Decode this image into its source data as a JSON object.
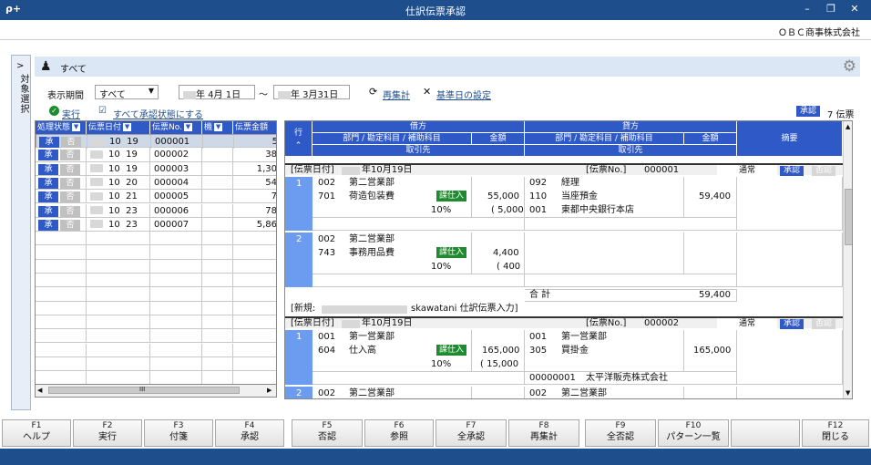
{
  "window": {
    "title": "仕訳伝票承認",
    "logo": "ρ+",
    "min": "–",
    "restore": "❐",
    "close": "✕",
    "company": "ＯＢＣ商事株式会社"
  },
  "side_tab": {
    "chevron": ">",
    "label": "対象選択"
  },
  "header_band": {
    "label": "すべて",
    "icon": "stamp-icon",
    "gear": "gear-icon"
  },
  "filters": {
    "period_label": "表示期間",
    "period_value": "すべて",
    "date_from_suffix": "年  4月  1日",
    "tilde": "～",
    "date_to_suffix": "年  3月31日",
    "recalc": "再集計",
    "base_date": "基準日の設定",
    "execute": "実行",
    "set_all": "すべて承認状態にする",
    "approved_badge": "承認",
    "count": "7 伝票"
  },
  "list": {
    "headers": [
      "処理状態",
      "伝票日付",
      "伝票No.",
      "機",
      "伝票金額"
    ],
    "approve": "承",
    "reject": "否",
    "rows": [
      {
        "mm": "10",
        "dd": "19",
        "no": "000001",
        "amt": "5"
      },
      {
        "mm": "10",
        "dd": "19",
        "no": "000002",
        "amt": "38"
      },
      {
        "mm": "10",
        "dd": "19",
        "no": "000003",
        "amt": "1,30"
      },
      {
        "mm": "10",
        "dd": "20",
        "no": "000004",
        "amt": "54"
      },
      {
        "mm": "10",
        "dd": "21",
        "no": "000005",
        "amt": "7"
      },
      {
        "mm": "10",
        "dd": "23",
        "no": "000006",
        "amt": "78"
      },
      {
        "mm": "10",
        "dd": "23",
        "no": "000007",
        "amt": "5,86"
      }
    ],
    "scroll_mark": "III"
  },
  "detail": {
    "col_row": "行",
    "debit": "借方",
    "credit": "貸方",
    "dept_acct": "部門 / 勘定科目 / 補助科目",
    "amount": "金額",
    "partner": "取引先",
    "memo": "摘要",
    "slips": [
      {
        "date_label": "[伝票日付]",
        "date": "年10月19日",
        "no_label": "[伝票No.]",
        "no": "000001",
        "normal": "通常",
        "approve": "承認",
        "reject": "否認",
        "lines": [
          {
            "n": "1",
            "d_dept_code": "002",
            "d_dept": "第二営業部",
            "d_acct_code": "701",
            "d_acct": "荷造包装費",
            "tax_badge": "課仕入",
            "d_amt": "55,000",
            "tax_rate": "10%",
            "tax_amt": "( 5,000",
            "c_dept_code": "092",
            "c_dept": "経理",
            "c_acct_code": "110",
            "c_acct": "当座預金",
            "c_sub_code": "001",
            "c_sub": "東都中央銀行本店",
            "c_amt": "59,400"
          },
          {
            "n": "2",
            "d_dept_code": "002",
            "d_dept": "第二営業部",
            "d_acct_code": "743",
            "d_acct": "事務用品費",
            "tax_badge": "課仕入",
            "d_amt": "4,400",
            "tax_rate": "10%",
            "tax_amt": "( 400"
          }
        ],
        "total_label": "合  計",
        "total": "59,400",
        "footer_prefix": "[新規:",
        "footer_user": "skawatani  仕訳伝票入力]"
      },
      {
        "date_label": "[伝票日付]",
        "date": "年10月19日",
        "no_label": "[伝票No.]",
        "no": "000002",
        "normal": "通常",
        "approve": "承認",
        "reject": "否認",
        "lines": [
          {
            "n": "1",
            "d_dept_code": "001",
            "d_dept": "第一営業部",
            "d_acct_code": "604",
            "d_acct": "仕入高",
            "tax_badge": "課仕入",
            "d_amt": "165,000",
            "tax_rate": "10%",
            "tax_amt": "( 15,000",
            "c_dept_code": "001",
            "c_dept": "第一営業部",
            "c_acct_code": "305",
            "c_acct": "買掛金",
            "c_amt": "165,000",
            "partner_code": "00000001",
            "partner": "太平洋販売株式会社"
          },
          {
            "n": "2",
            "d_dept_code": "002",
            "d_dept": "第二営業部",
            "c_dept_code": "002",
            "c_dept": "第二営業部"
          }
        ]
      }
    ]
  },
  "fkeys": [
    {
      "k": "F1",
      "l": "ヘルプ"
    },
    {
      "k": "F2",
      "l": "実行"
    },
    {
      "k": "F3",
      "l": "付箋"
    },
    {
      "k": "F4",
      "l": "承認"
    },
    {
      "k": "F5",
      "l": "否認"
    },
    {
      "k": "F6",
      "l": "参照"
    },
    {
      "k": "F7",
      "l": "全承認"
    },
    {
      "k": "F8",
      "l": "再集計"
    },
    {
      "k": "F9",
      "l": "全否認"
    },
    {
      "k": "F10",
      "l": "パターン一覧"
    },
    {
      "k": "",
      "l": ""
    },
    {
      "k": "F12",
      "l": "閉じる"
    }
  ]
}
